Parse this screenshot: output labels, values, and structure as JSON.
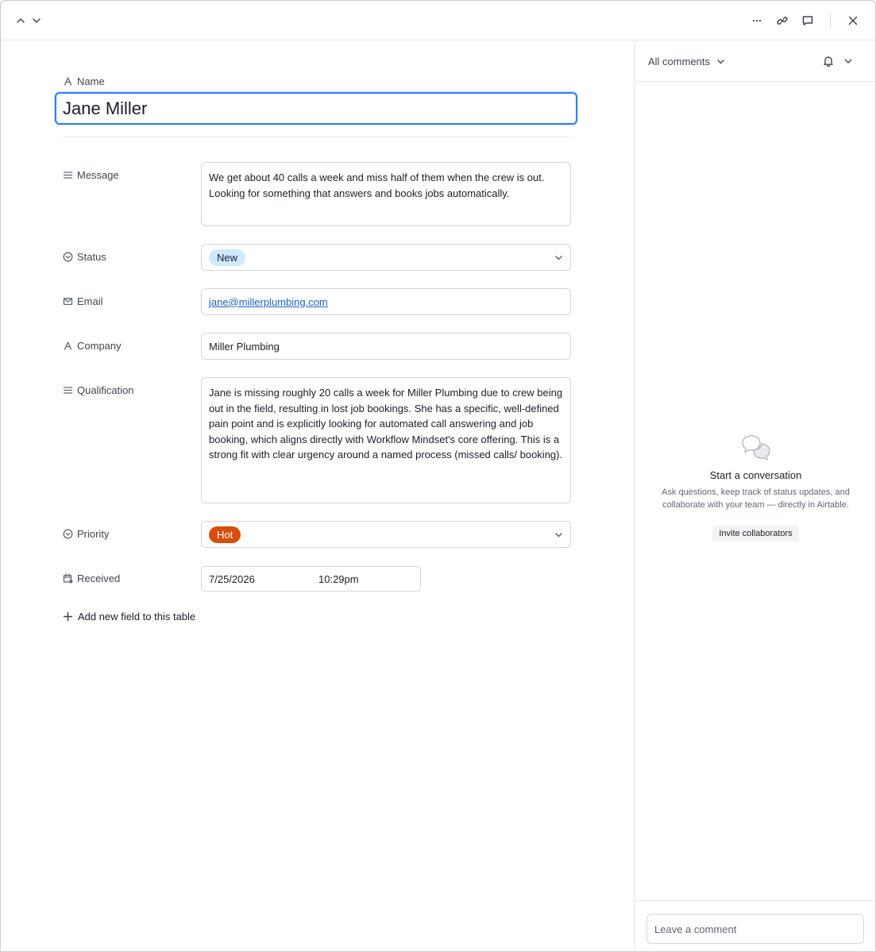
{
  "record": {
    "name_label": "Name",
    "name_value": "Jane Miller",
    "fields": {
      "message": {
        "label": "Message",
        "value": "We get about 40 calls a week and miss half of them when the crew is out.\nLooking for something that answers and books jobs automatically."
      },
      "status": {
        "label": "Status",
        "value": "New",
        "color": "#cfeafe"
      },
      "email": {
        "label": "Email",
        "value": "jane@millerplumbing.com"
      },
      "company": {
        "label": "Company",
        "value": "Miller Plumbing"
      },
      "qualification": {
        "label": "Qualification",
        "value": "Jane is missing roughly 20 calls a week for Miller Plumbing due to crew being out in the field, resulting in lost job bookings. She has a specific, well-defined pain point and is explicitly looking for automated call answering and job booking, which aligns directly with Workflow Mindset's core offering. This is a strong fit with clear urgency around a named process (missed calls/ booking)."
      },
      "priority": {
        "label": "Priority",
        "value": "Hot",
        "color": "#d74d0b"
      },
      "received": {
        "label": "Received",
        "date": "7/25/2026",
        "time": "10:29pm"
      }
    },
    "add_field_label": "Add new field to this table"
  },
  "toolbar": {
    "icons": [
      "chevron-up-icon",
      "chevron-down-icon",
      "more-icon",
      "link-icon",
      "comment-icon",
      "close-icon"
    ]
  },
  "comments": {
    "filter_label": "All comments",
    "empty_title": "Start a conversation",
    "empty_subtitle": "Ask questions, keep track of status updates, and collaborate with your team — directly in Airtable.",
    "invite_label": "Invite collaborators",
    "input_placeholder": "Leave a comment"
  }
}
